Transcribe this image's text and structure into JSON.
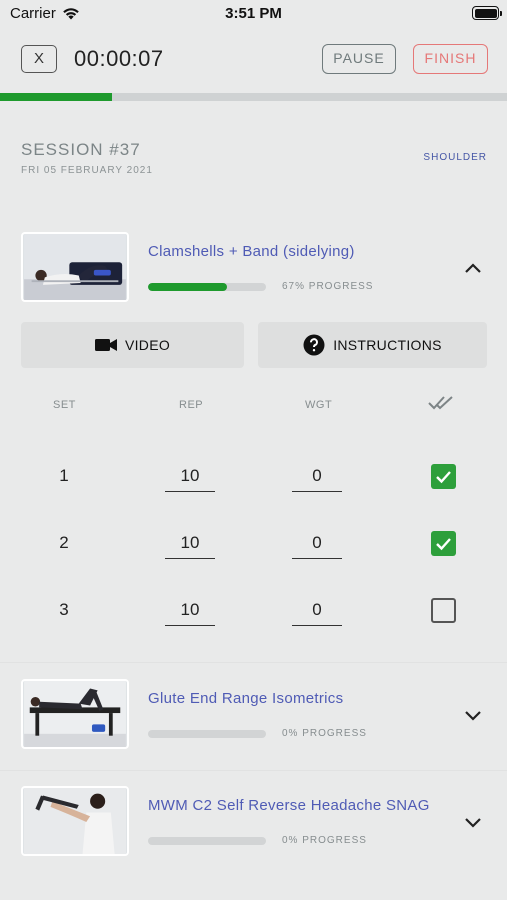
{
  "status_bar": {
    "carrier": "Carrier",
    "time": "3:51 PM"
  },
  "top_bar": {
    "close_label": "X",
    "timer": "00:00:07",
    "pause_label": "PAUSE",
    "finish_label": "FINISH"
  },
  "session_progress": 0.22,
  "session": {
    "title": "SESSION #37",
    "date": "FRI 05 FEBRUARY 2021",
    "tag": "SHOULDER"
  },
  "exercises": [
    {
      "name": "Clamshells + Band (sidelying)",
      "progress": 0.67,
      "progress_label": "67% PROGRESS",
      "expanded": true,
      "video_label": "VIDEO",
      "instructions_label": "INSTRUCTIONS",
      "columns": [
        "SET",
        "REP",
        "WGT"
      ],
      "sets": [
        {
          "set": "1",
          "rep": "10",
          "wgt": "0",
          "done": true
        },
        {
          "set": "2",
          "rep": "10",
          "wgt": "0",
          "done": true
        },
        {
          "set": "3",
          "rep": "10",
          "wgt": "0",
          "done": false
        }
      ]
    },
    {
      "name": "Glute End Range Isometrics",
      "progress": 0.0,
      "progress_label": "0% PROGRESS",
      "expanded": false
    },
    {
      "name": "MWM C2 Self Reverse Headache SNAG",
      "progress": 0.0,
      "progress_label": "0% PROGRESS",
      "expanded": false
    }
  ],
  "icons": {
    "wifi": "wifi-icon",
    "battery": "battery-icon",
    "video": "video-camera-icon",
    "instructions": "question-circle-icon",
    "done_all": "double-check-icon",
    "chevron_up": "chevron-up-icon",
    "chevron_down": "chevron-down-icon",
    "checkbox_checked": "checkbox-checked-icon",
    "checkbox_empty": "checkbox-empty-icon"
  },
  "colors": {
    "background": "#e9eaea",
    "accent_green": "#1e9a2d",
    "title_blue": "#4f5bb5",
    "finish_red": "#e57878"
  }
}
